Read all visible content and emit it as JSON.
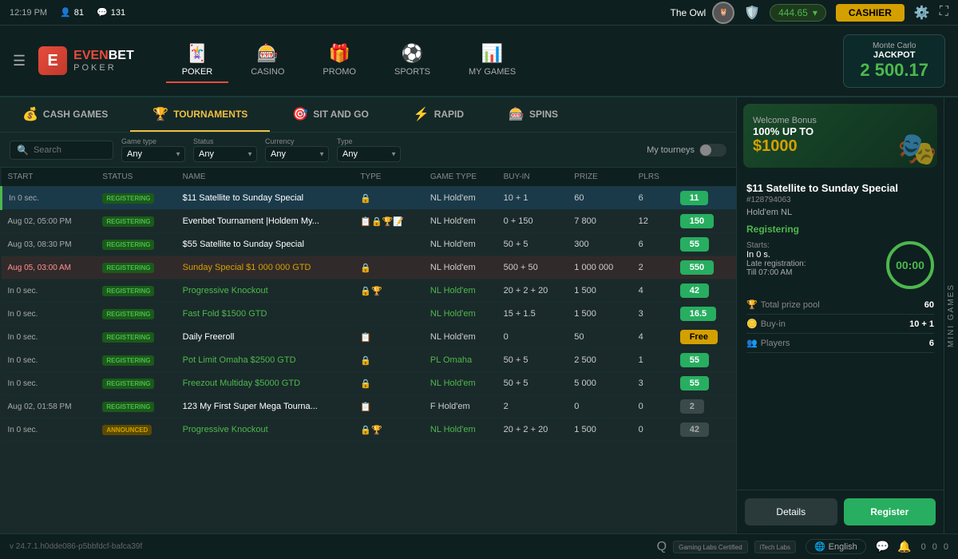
{
  "topbar": {
    "time": "12:19 PM",
    "users_icon": "👤",
    "users_count": "81",
    "chat_icon": "💬",
    "chat_count": "131",
    "username": "The Owl",
    "balance": "444.65",
    "cashier_label": "CASHIER"
  },
  "nav": {
    "logo_letter": "E",
    "logo_even": "EVEN",
    "logo_bet": "BET",
    "logo_poker": "POKER",
    "items": [
      {
        "emoji": "🃏",
        "label": "POKER",
        "active": true
      },
      {
        "emoji": "🎰",
        "label": "CASINO",
        "active": false
      },
      {
        "emoji": "🎁",
        "label": "PROMO",
        "active": false
      },
      {
        "emoji": "⚽",
        "label": "SPORTS",
        "active": false
      },
      {
        "emoji": "📊",
        "label": "MY GAMES",
        "active": false
      }
    ],
    "jackpot_location": "Monte Carlo",
    "jackpot_label": "JACKPOT",
    "jackpot_value": "2 500.17"
  },
  "tabs": [
    {
      "emoji": "💰",
      "label": "CASH GAMES",
      "active": false
    },
    {
      "emoji": "🏆",
      "label": "TOURNAMENTS",
      "active": true
    },
    {
      "emoji": "🎯",
      "label": "SIT AND GO",
      "active": false
    },
    {
      "emoji": "⚡",
      "label": "RAPID",
      "active": false
    },
    {
      "emoji": "🎰",
      "label": "SPINS",
      "active": false
    }
  ],
  "filters": {
    "search_placeholder": "Search",
    "game_type_label": "Game type",
    "game_type_value": "Any",
    "status_label": "Status",
    "status_value": "Any",
    "currency_label": "Currency",
    "currency_value": "Any",
    "type_label": "Type",
    "type_value": "Any",
    "my_tourneys_label": "My tourneys"
  },
  "table": {
    "headers": [
      "START",
      "STATUS",
      "NAME",
      "TYPE",
      "GAME TYPE",
      "BUY-IN",
      "PRIZE",
      "PLRS",
      ""
    ],
    "rows": [
      {
        "start": "In 0 sec.",
        "status": "REGISTERING",
        "status_type": "registering",
        "name": "$11 Satellite to Sunday Special",
        "name_color": "white",
        "type_icons": "🔒",
        "game_type": "NL Hold'em",
        "buy_in": "10 + 1",
        "prize": "60",
        "plrs": "6",
        "btn": "11",
        "btn_type": "green",
        "selected": true,
        "row_class": "selected"
      },
      {
        "start": "Aug 02, 05:00 PM",
        "status": "REGISTERING",
        "status_type": "registering",
        "name": "Evenbet Tournament |Holdem My...",
        "name_color": "white",
        "type_icons": "📋🔒🏆📝",
        "game_type": "NL Hold'em",
        "buy_in": "0 + 150",
        "prize": "7 800",
        "plrs": "12",
        "btn": "150",
        "btn_type": "green",
        "selected": false,
        "row_class": ""
      },
      {
        "start": "Aug 03, 08:30 PM",
        "status": "REGISTERING",
        "status_type": "registering",
        "name": "$55 Satellite to Sunday Special",
        "name_color": "white",
        "type_icons": "",
        "game_type": "NL Hold'em",
        "buy_in": "50 + 5",
        "prize": "300",
        "plrs": "6",
        "btn": "55",
        "btn_type": "green",
        "selected": false,
        "row_class": ""
      },
      {
        "start": "Aug 05, 03:00 AM",
        "status": "REGISTERING",
        "status_type": "registering",
        "name": "Sunday Special $1 000 000 GTD",
        "name_color": "gold",
        "type_icons": "🔒",
        "game_type": "NL Hold'em",
        "buy_in": "500 + 50",
        "prize": "1 000 000",
        "plrs": "2",
        "btn": "550",
        "btn_type": "green",
        "selected": false,
        "row_class": "pink-row"
      },
      {
        "start": "In 0 sec.",
        "status": "REGISTERING",
        "status_type": "registering",
        "name": "Progressive Knockout",
        "name_color": "green",
        "type_icons": "🔒🏆",
        "game_type": "NL Hold'em",
        "buy_in": "20 + 2 + 20",
        "prize": "1 500",
        "plrs": "4",
        "btn": "42",
        "btn_type": "green",
        "selected": false,
        "row_class": ""
      },
      {
        "start": "In 0 sec.",
        "status": "REGISTERING",
        "status_type": "registering",
        "name": "Fast Fold $1500 GTD",
        "name_color": "green",
        "type_icons": "",
        "game_type": "NL Hold'em",
        "buy_in": "15 + 1.5",
        "prize": "1 500",
        "plrs": "3",
        "btn": "16.5",
        "btn_type": "green",
        "selected": false,
        "row_class": ""
      },
      {
        "start": "In 0 sec.",
        "status": "REGISTERING",
        "status_type": "registering",
        "name": "Daily Freeroll",
        "name_color": "white",
        "type_icons": "📋",
        "game_type": "NL Hold'em",
        "buy_in": "0",
        "prize": "50",
        "plrs": "4",
        "btn": "Free",
        "btn_type": "gold",
        "selected": false,
        "row_class": ""
      },
      {
        "start": "In 0 sec.",
        "status": "REGISTERING",
        "status_type": "registering",
        "name": "Pot Limit Omaha $2500 GTD",
        "name_color": "green",
        "type_icons": "🔒",
        "game_type": "PL Omaha",
        "buy_in": "50 + 5",
        "prize": "2 500",
        "plrs": "1",
        "btn": "55",
        "btn_type": "green",
        "selected": false,
        "row_class": ""
      },
      {
        "start": "In 0 sec.",
        "status": "REGISTERING",
        "status_type": "registering",
        "name": "Freezout Multiday $5000 GTD",
        "name_color": "green",
        "type_icons": "🔒",
        "game_type": "NL Hold'em",
        "buy_in": "50 + 5",
        "prize": "5 000",
        "plrs": "3",
        "btn": "55",
        "btn_type": "green",
        "selected": false,
        "row_class": ""
      },
      {
        "start": "Aug 02, 01:58 PM",
        "status": "REGISTERING",
        "status_type": "registering",
        "name": "123 My First Super Mega Tourna...",
        "name_color": "white",
        "type_icons": "📋",
        "game_type": "F Hold'em",
        "buy_in": "2",
        "prize": "0",
        "plrs": "0",
        "btn": "2",
        "btn_type": "gray",
        "selected": false,
        "row_class": ""
      },
      {
        "start": "In 0 sec.",
        "status": "ANNOUNCED",
        "status_type": "announced",
        "name": "Progressive Knockout",
        "name_color": "green",
        "type_icons": "🔒🏆",
        "game_type": "NL Hold'em",
        "buy_in": "20 + 2 + 20",
        "prize": "1 500",
        "plrs": "0",
        "btn": "42",
        "btn_type": "gray",
        "selected": false,
        "row_class": ""
      }
    ]
  },
  "right_panel": {
    "bonus_title": "Welcome Bonus",
    "bonus_subtitle": "100% UP TO",
    "bonus_amount": "$1000",
    "detail_title": "$11 Satellite to Sunday Special",
    "detail_id": "#128794063",
    "detail_mode": "Hold'em NL",
    "status_label": "Registering",
    "starts_label": "Starts:",
    "starts_value": "In 0 s.",
    "late_reg_label": "Late registration:",
    "late_reg_value": "Till 07:00 AM",
    "timer_value": "00:00",
    "prize_label": "Total prize pool",
    "prize_value": "60",
    "buyin_label": "Buy-in",
    "buyin_value": "10 + 1",
    "players_label": "Players",
    "players_value": "6",
    "details_btn": "Details",
    "register_btn": "Register"
  },
  "footer": {
    "version": "v 24.7.1.h0dde086-p5bbfdcf-bafca39f",
    "language": "English",
    "gaming_labs": "Gaming\nLabs Certified",
    "itech": "iTech\nLabs",
    "counter1": "0",
    "counter2": "0",
    "counter3": "0"
  },
  "mini_games": {
    "label": "MINI GAMES"
  }
}
